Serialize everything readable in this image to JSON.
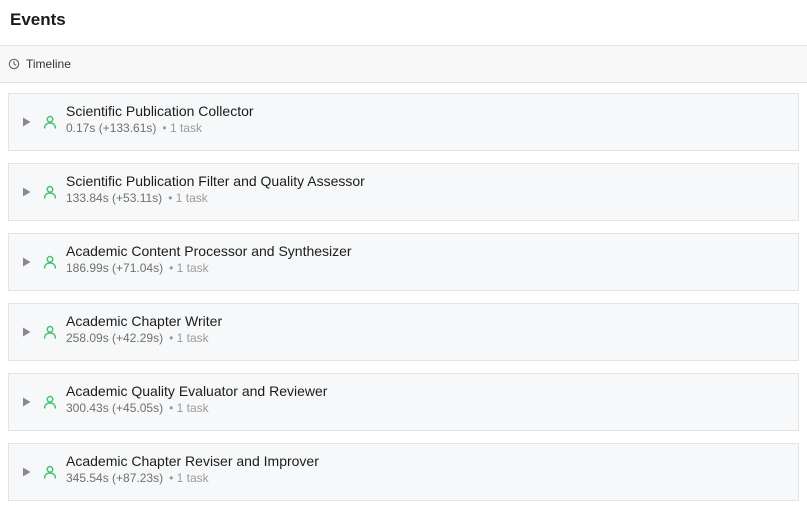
{
  "header": {
    "title": "Events"
  },
  "subheader": {
    "icon": "clock-icon",
    "tab_label": "Timeline"
  },
  "colors": {
    "agent_icon": "#3ec46d",
    "expand_icon": "#8a8a8a",
    "card_bg": "#f7f8f9",
    "card_border": "#e3e3e3"
  },
  "events": [
    {
      "title": "Scientific Publication Collector",
      "time": "0.17s (+133.61s)",
      "sep": "•",
      "tasks": "1 task"
    },
    {
      "title": "Scientific Publication Filter and Quality Assessor",
      "time": "133.84s (+53.11s)",
      "sep": "•",
      "tasks": "1 task"
    },
    {
      "title": "Academic Content Processor and Synthesizer",
      "time": "186.99s (+71.04s)",
      "sep": "•",
      "tasks": "1 task"
    },
    {
      "title": "Academic Chapter Writer",
      "time": "258.09s (+42.29s)",
      "sep": "•",
      "tasks": "1 task"
    },
    {
      "title": "Academic Quality Evaluator and Reviewer",
      "time": "300.43s (+45.05s)",
      "sep": "•",
      "tasks": "1 task"
    },
    {
      "title": "Academic Chapter Reviser and Improver",
      "time": "345.54s (+87.23s)",
      "sep": "•",
      "tasks": "1 task"
    }
  ]
}
